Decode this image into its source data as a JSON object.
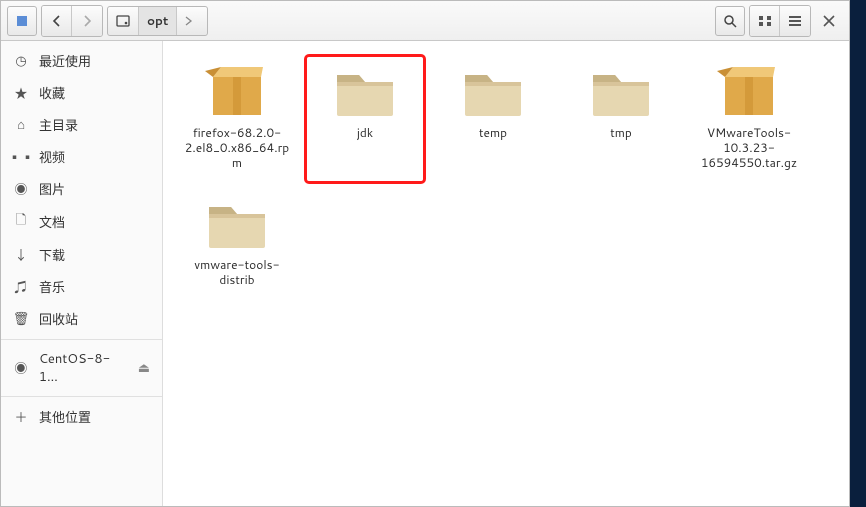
{
  "toolbar": {
    "path_current": "opt"
  },
  "sidebar": {
    "items": [
      {
        "label": "最近使用",
        "icon": "clock"
      },
      {
        "label": "收藏",
        "icon": "star"
      },
      {
        "label": "主目录",
        "icon": "home"
      },
      {
        "label": "视频",
        "icon": "video"
      },
      {
        "label": "图片",
        "icon": "camera"
      },
      {
        "label": "文档",
        "icon": "doc"
      },
      {
        "label": "下载",
        "icon": "download"
      },
      {
        "label": "音乐",
        "icon": "music"
      },
      {
        "label": "回收站",
        "icon": "trash"
      }
    ],
    "device": {
      "label": "CentOS-8-1…",
      "eject": true
    },
    "other": {
      "label": "其他位置"
    }
  },
  "files": [
    {
      "name": "firefox-68.2.0-2.el8_0.x86_64.rpm",
      "type": "archive",
      "highlight": false
    },
    {
      "name": "jdk",
      "type": "folder",
      "highlight": true
    },
    {
      "name": "temp",
      "type": "folder",
      "highlight": false
    },
    {
      "name": "tmp",
      "type": "folder",
      "highlight": false
    },
    {
      "name": "VMwareTools-10.3.23-16594550.tar.gz",
      "type": "archive",
      "highlight": false
    },
    {
      "name": "vmware-tools-distrib",
      "type": "folder",
      "highlight": false
    }
  ]
}
